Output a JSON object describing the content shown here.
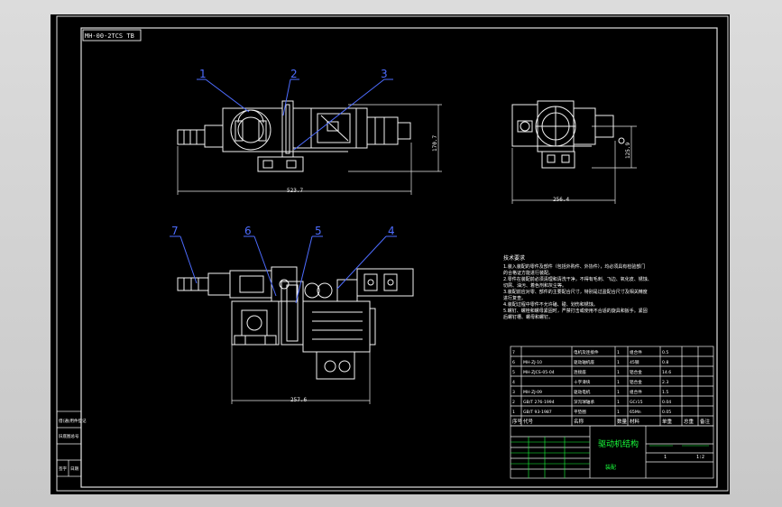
{
  "drawing": {
    "number_stamp": "MH-00-2TCS TB",
    "balloons": [
      "1",
      "2",
      "3",
      "4",
      "5",
      "6",
      "7"
    ],
    "dimensions": {
      "front_width": "523.7",
      "front_height": "170.7",
      "side_width": "256.4",
      "side_height": "125.9",
      "top_width": "257.6"
    }
  },
  "tech_requirements": {
    "title": "技术要求",
    "lines": [
      "1.装入装配的零件及部件（包括外购件、外协件），均必须具有检验部门",
      "的合格证方能进行装配。",
      "2.零件在装配前必须清理和清洗干净，不得有毛刺、飞边、氧化皮、锈蚀、",
      "切屑、油污、着色剂和灰尘等。",
      "3.装配前应对零、部件的主要配合尺寸，特别是过盈配合尺寸及相关精度",
      "进行复查。",
      "4.装配过程中零件不允许磕、碰、划伤和锈蚀。",
      "5.螺钉、螺栓和螺母紧固时，严禁打击或使用不合适的旋具和扳手。紧固",
      "后螺钉槽、螺母和螺钉。"
    ]
  },
  "bom": {
    "rows": [
      [
        "7",
        "",
        "电机及连接件",
        "1",
        "组合件",
        "0.5"
      ],
      [
        "6",
        "MH-ZJ-10",
        "驱动轴机座",
        "1",
        "45钢",
        "0.8"
      ],
      [
        "5",
        "MH-ZJCS-05-04",
        "连接座",
        "1",
        "铝合金",
        "14.6"
      ],
      [
        "4",
        "",
        "十字滑块",
        "1",
        "铝合金",
        "2.3"
      ],
      [
        "3",
        "MH-ZJ-09",
        "驱动电机",
        "1",
        "组合件",
        "1.5"
      ],
      [
        "2",
        "GB/T 276-1994",
        "深沟球轴承",
        "1",
        "GCr15",
        "0.04"
      ],
      [
        "1",
        "GB/T 93-1987",
        "平垫圈",
        "1",
        "65Mn",
        "0.05"
      ]
    ],
    "header": [
      "序号",
      "代号",
      "名称",
      "数量",
      "材料",
      "单重",
      "总重",
      "备注"
    ]
  },
  "title_block": {
    "title": "驱动机结构",
    "subtitle": "装配",
    "scale": "1:2",
    "sheet": "1"
  },
  "side_stamp": [
    "借(通)用件登记",
    "旧底图总号",
    "签字",
    "日期"
  ]
}
